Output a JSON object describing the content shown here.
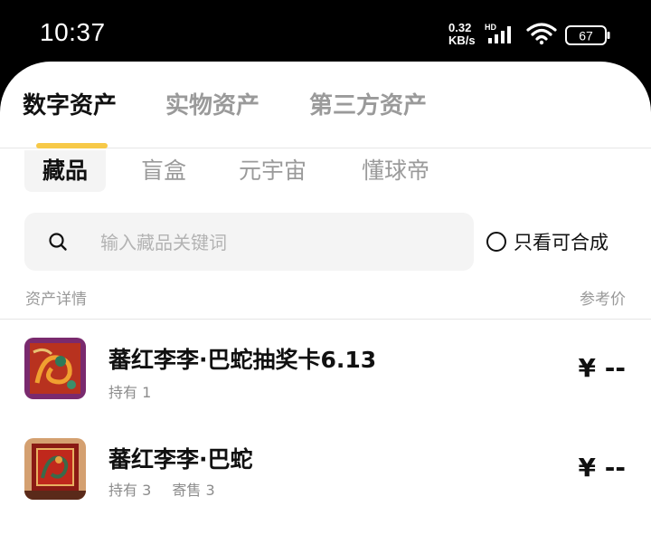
{
  "status": {
    "time": "10:37",
    "net_speed_value": "0.32",
    "net_speed_unit": "KB/s",
    "signal_label": "HD",
    "battery_level": "67"
  },
  "main_tabs": [
    {
      "label": "数字资产",
      "active": true
    },
    {
      "label": "实物资产",
      "active": false
    },
    {
      "label": "第三方资产",
      "active": false
    }
  ],
  "sub_tabs": [
    {
      "label": "藏品",
      "active": true
    },
    {
      "label": "盲盒",
      "active": false
    },
    {
      "label": "元宇宙",
      "active": false
    },
    {
      "label": "懂球帝",
      "active": false
    }
  ],
  "search": {
    "placeholder": "输入藏品关键词",
    "value": ""
  },
  "filter": {
    "label": "只看可合成",
    "checked": false
  },
  "list_header": {
    "left": "资产详情",
    "right": "参考价"
  },
  "assets": [
    {
      "name": "蕃红李李·巴蛇抽奖卡6.13",
      "hold": "持有 1",
      "consign": "",
      "price": "¥ --"
    },
    {
      "name": "蕃红李李·巴蛇",
      "hold": "持有 3",
      "consign": "寄售 3",
      "price": "¥ --"
    }
  ],
  "colors": {
    "accent": "#f7c948",
    "text": "#111111",
    "muted": "#9a9a9a"
  }
}
